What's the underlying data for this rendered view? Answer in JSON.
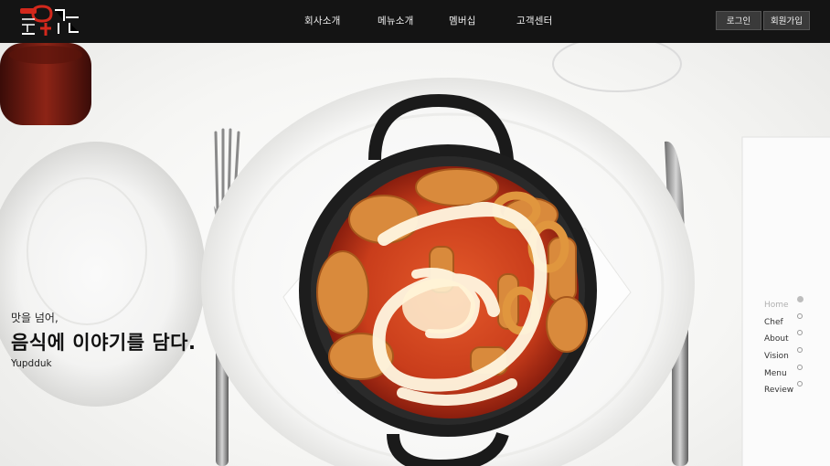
{
  "header": {
    "logo_alt": "동대문 엽기떡볶이",
    "nav": [
      "회사소개",
      "메뉴소개",
      "멤버십",
      "고객센터"
    ],
    "login": "로그인",
    "signup": "회원가입"
  },
  "hero": {
    "subtitle": "맛을 넘어,",
    "title": "음식에 이야기를 담다.",
    "brand": "Yupdduk"
  },
  "sidenav": {
    "items": [
      "Home",
      "Chef",
      "About",
      "Vision",
      "Menu",
      "Review"
    ],
    "active": "Home"
  },
  "colors": {
    "topbar": "#141414",
    "sauce": "#c8381c",
    "pan": "#1d1d1d",
    "plate": "#ffffff"
  }
}
